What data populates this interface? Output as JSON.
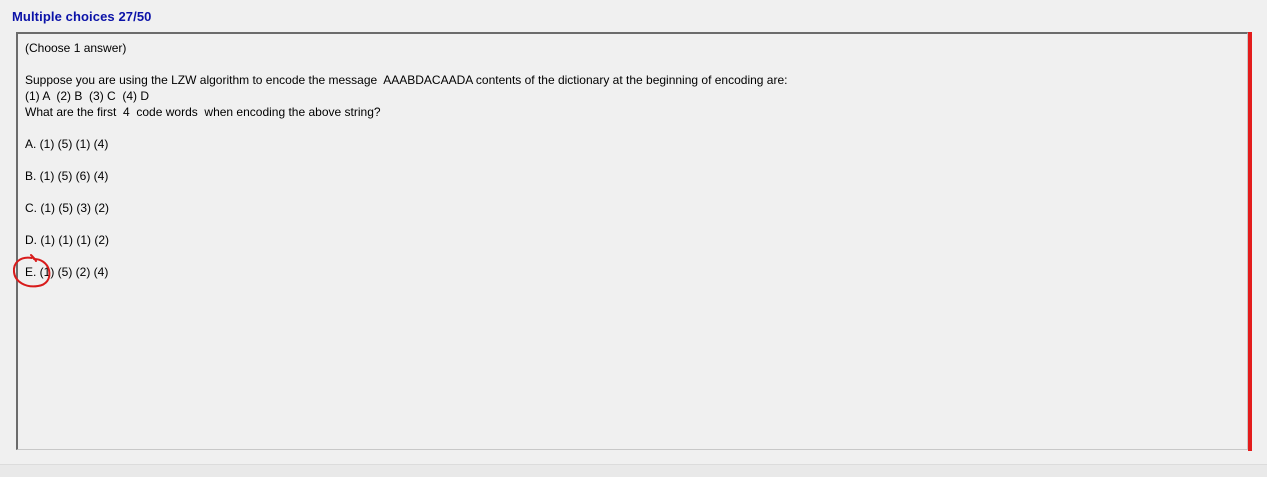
{
  "header": {
    "title": "Multiple choices 27/50"
  },
  "question": {
    "instruction": "(Choose 1 answer)",
    "prompt_line": "Suppose you are using the LZW algorithm to encode the message  AAABDACAADA contents of the dictionary at the beginning of encoding are:",
    "dictionary_line": "(1) A  (2) B  (3) C  (4) D",
    "ask_line": "What are the first  4  code words  when encoding the above string?"
  },
  "options": [
    {
      "letter": "A.",
      "text": " (1) (5) (1) (4)"
    },
    {
      "letter": "B.",
      "text": " (1) (5) (6) (4)"
    },
    {
      "letter": "C.",
      "text": " (1) (5) (3) (2)"
    },
    {
      "letter": "D.",
      "text": " (1) (1) (1) (2)"
    },
    {
      "letter": "E.",
      "text": " (1) (5) (2) (4)"
    }
  ],
  "colors": {
    "title": "#0b12a8",
    "accent_bar": "#e31c1c",
    "annotation": "#d81b1b",
    "background": "#f0f0f0"
  }
}
